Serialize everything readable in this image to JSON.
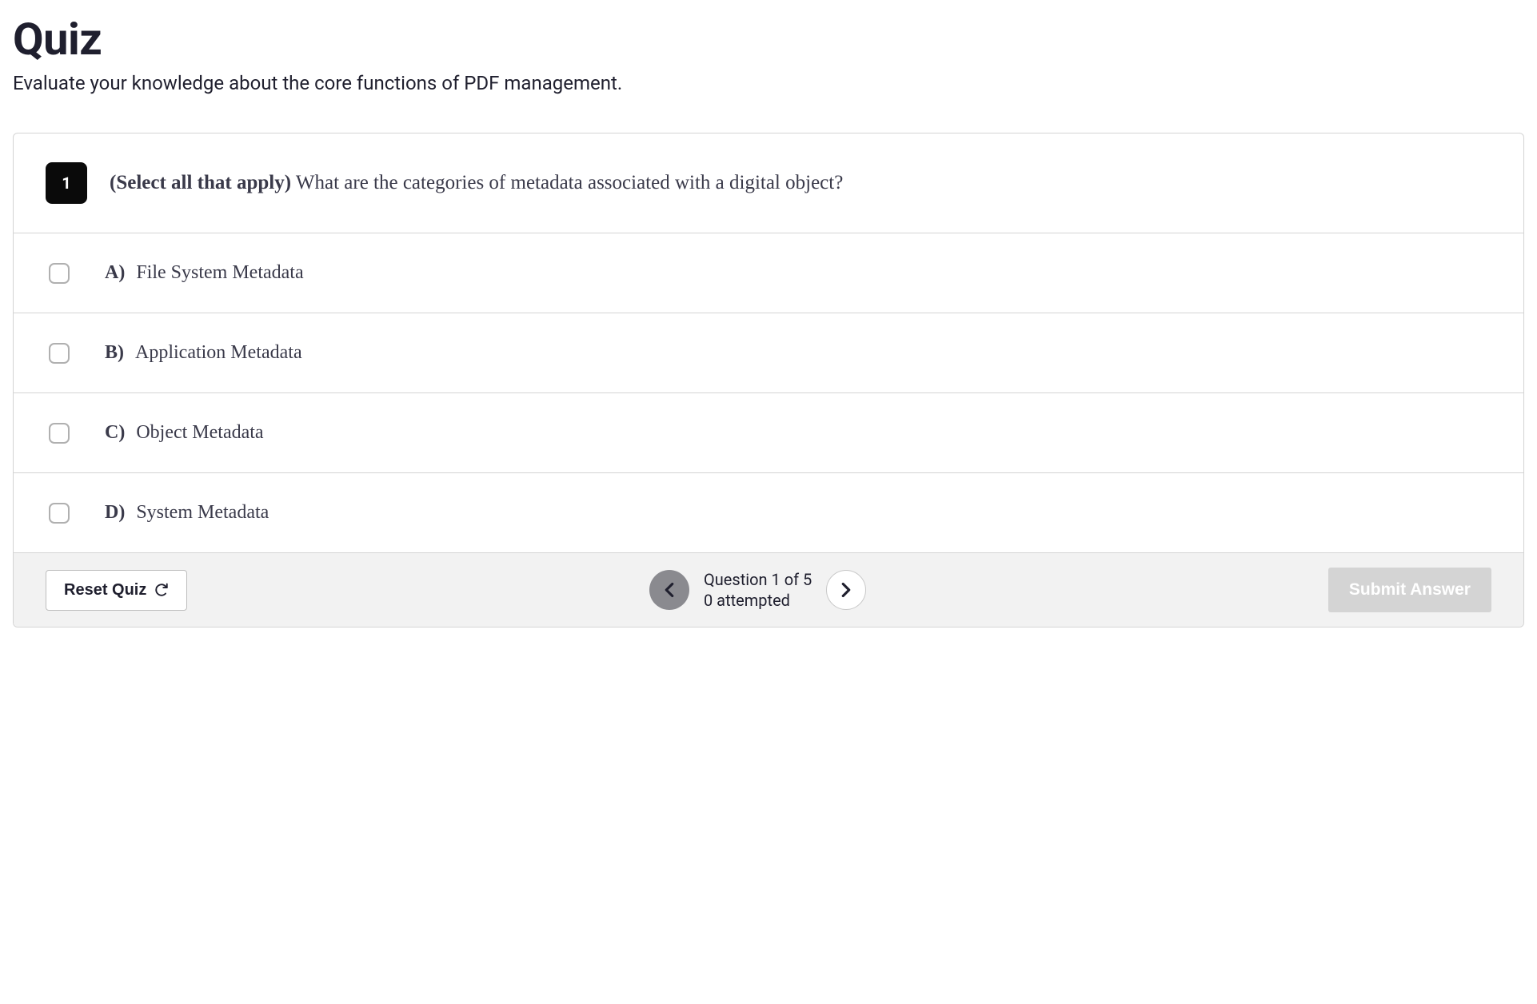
{
  "header": {
    "title": "Quiz",
    "subtitle": "Evaluate your knowledge about the core functions of PDF management."
  },
  "question": {
    "number": "1",
    "prefix": "(Select all that apply)",
    "text": "What are the categories of metadata associated with a digital object?"
  },
  "options": [
    {
      "letter": "A)",
      "text": "File System Metadata"
    },
    {
      "letter": "B)",
      "text": "Application Metadata"
    },
    {
      "letter": "C)",
      "text": "Object Metadata"
    },
    {
      "letter": "D)",
      "text": "System Metadata"
    }
  ],
  "footer": {
    "reset_label": "Reset Quiz",
    "pagination_line1": "Question 1 of 5",
    "pagination_line2": "0 attempted",
    "submit_label": "Submit Answer"
  }
}
